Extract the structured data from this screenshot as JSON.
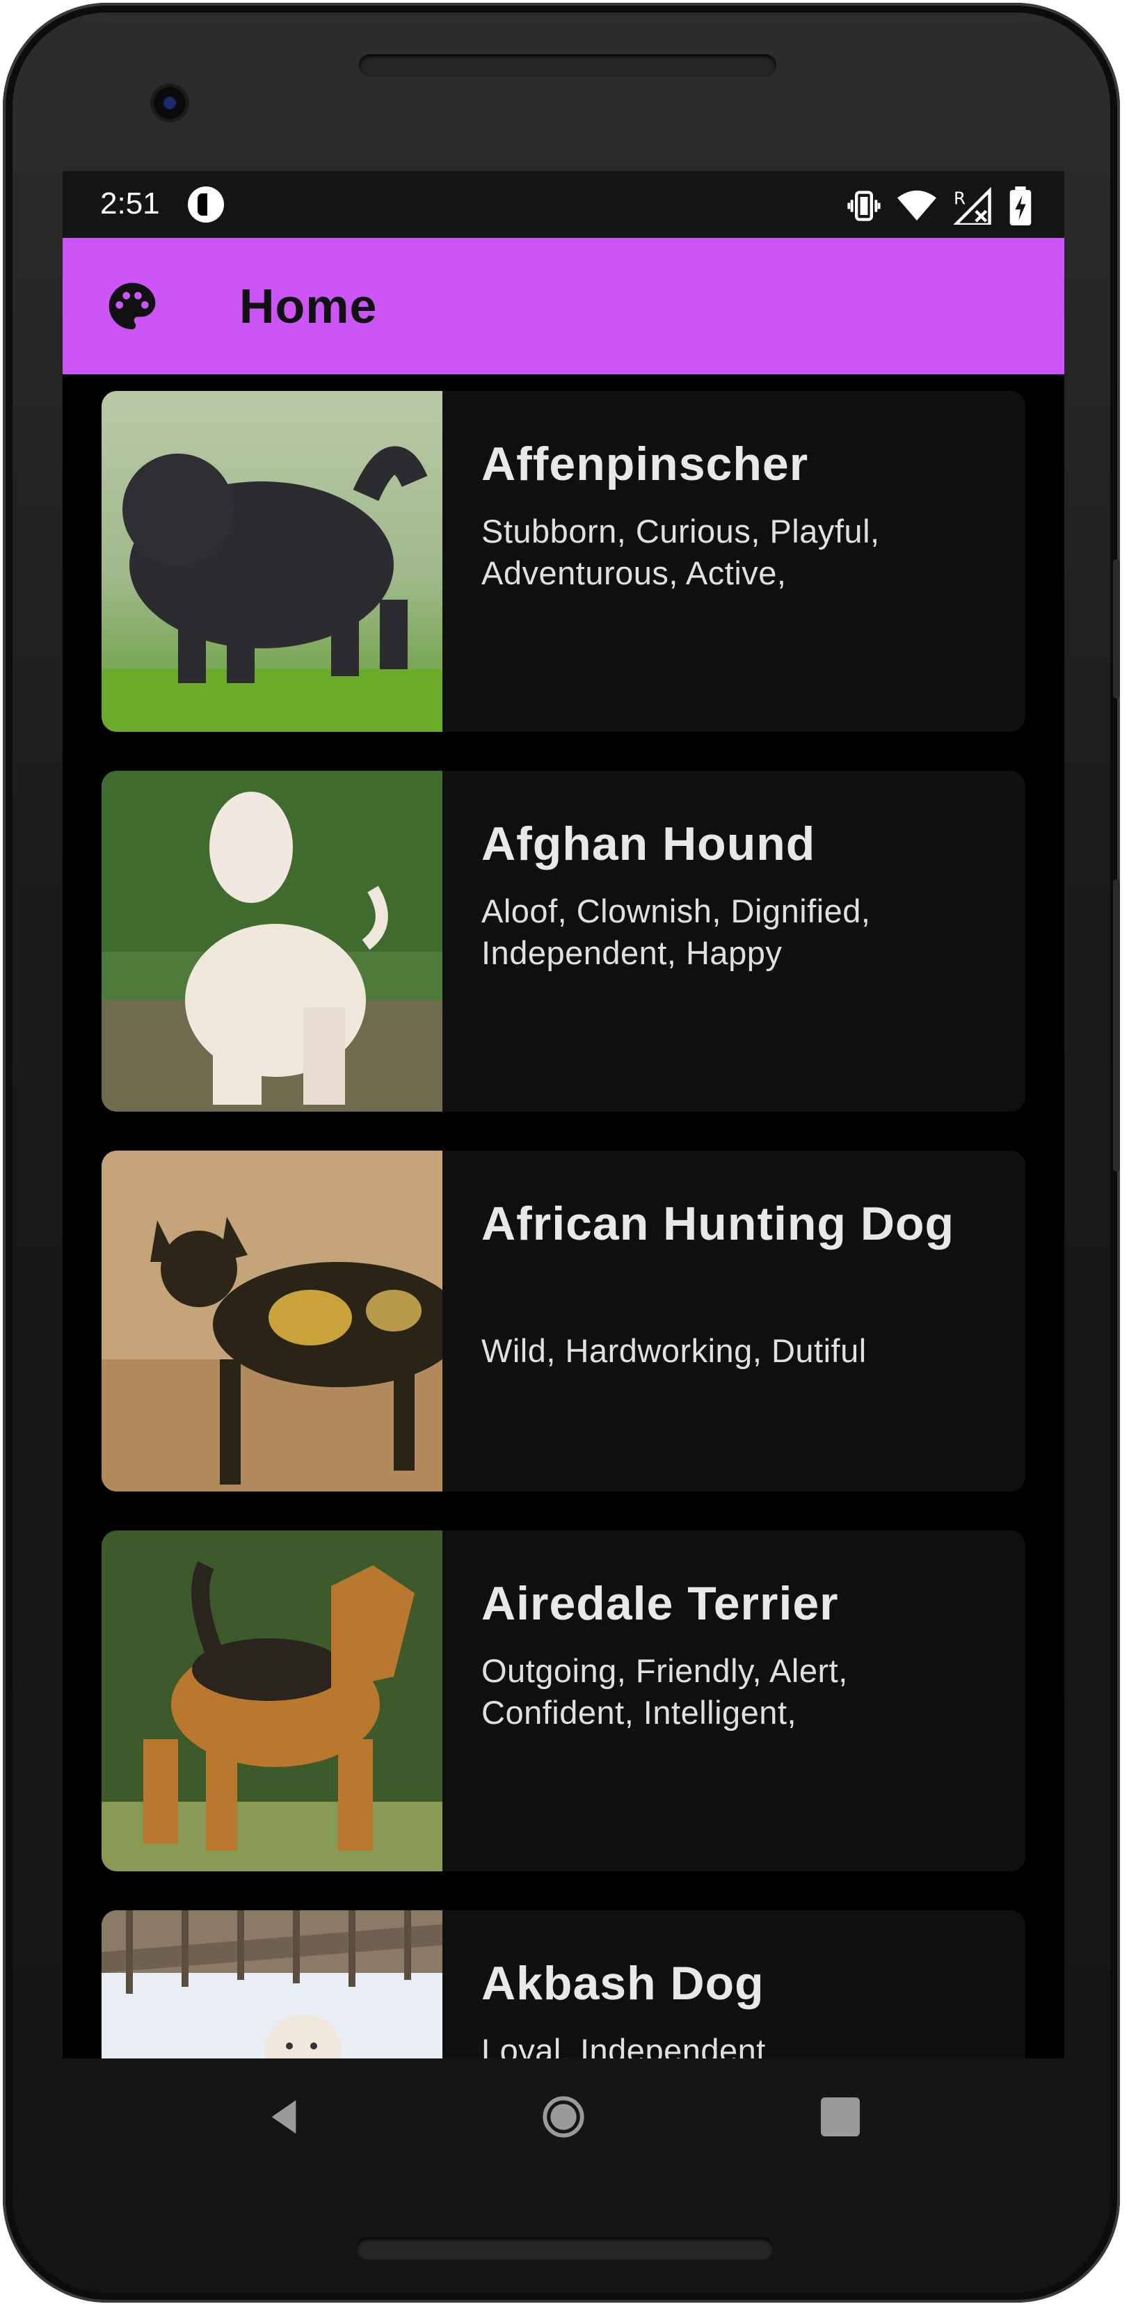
{
  "status_bar": {
    "time": "2:51",
    "icons": [
      "app-notification-icon",
      "vibrate-icon",
      "wifi-icon",
      "signal-icon",
      "battery-icon"
    ],
    "signal_label": "R"
  },
  "app_bar": {
    "icon": "palette-icon",
    "title": "Home",
    "background": "#cd55f7"
  },
  "dogs": [
    {
      "name": "Affenpinscher",
      "traits": "Stubborn, Curious, Playful, Adventurous, Active,",
      "image": "black shaggy dog on grass"
    },
    {
      "name": "Afghan Hound",
      "traits": "Aloof, Clownish, Dignified, Independent, Happy",
      "image": "white long-haired hound in field"
    },
    {
      "name": "African Hunting Dog",
      "traits": "Wild, Hardworking, Dutiful",
      "image": "spotted wild dog in dry grass"
    },
    {
      "name": "Airedale Terrier",
      "traits": "Outgoing, Friendly, Alert, Confident, Intelligent,",
      "image": "tan and black terrier standing"
    },
    {
      "name": "Akbash Dog",
      "traits": "Loyal, Independent",
      "image": "white dog in snow"
    }
  ],
  "nav_bar": {
    "buttons": [
      "back-icon",
      "home-icon",
      "recents-icon"
    ]
  },
  "colors": {
    "screen_bg": "#000000",
    "card_bg": "#0f0f0f",
    "text": "#e8e8e8"
  }
}
